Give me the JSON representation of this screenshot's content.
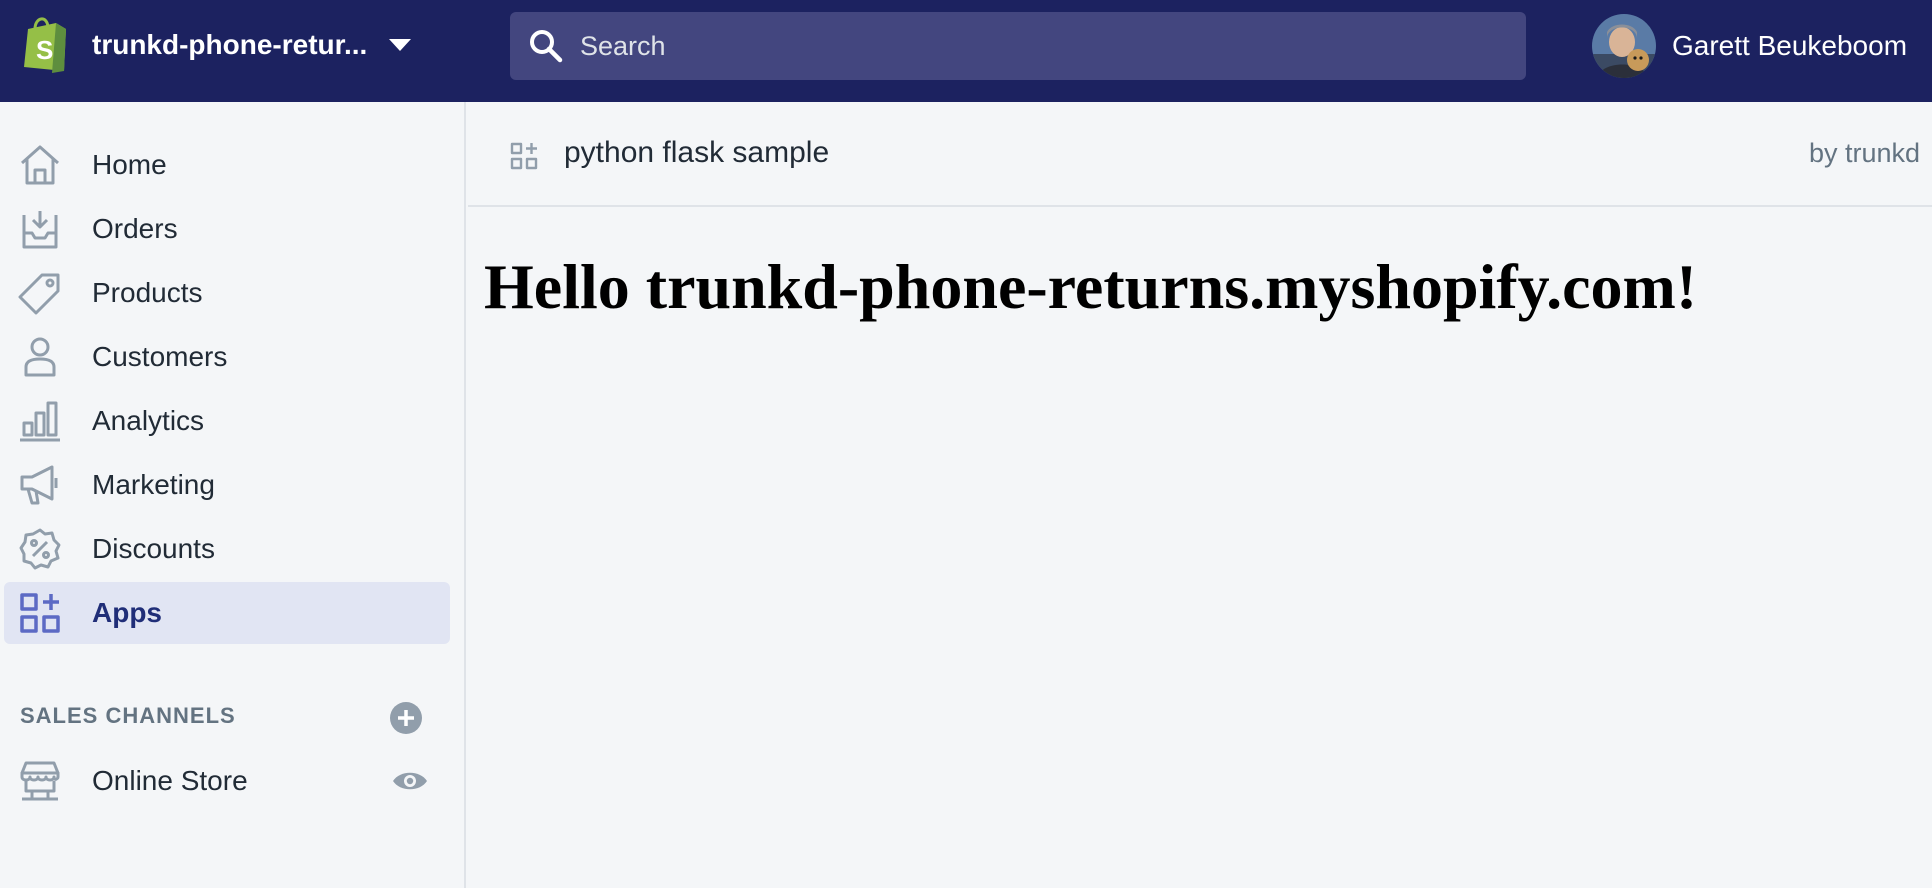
{
  "topbar": {
    "store_name": "trunkd-phone-retur...",
    "search_placeholder": "Search",
    "user_name": "Garett Beukeboom",
    "icons": {
      "logo": "shopify-bag-icon",
      "caret": "chevron-down-icon",
      "search": "search-icon",
      "avatar": "user-avatar"
    }
  },
  "sidebar": {
    "items": [
      {
        "label": "Home",
        "icon": "home-icon"
      },
      {
        "label": "Orders",
        "icon": "orders-inbox-icon"
      },
      {
        "label": "Products",
        "icon": "tag-icon"
      },
      {
        "label": "Customers",
        "icon": "person-icon"
      },
      {
        "label": "Analytics",
        "icon": "bar-chart-icon"
      },
      {
        "label": "Marketing",
        "icon": "megaphone-icon"
      },
      {
        "label": "Discounts",
        "icon": "discount-badge-icon"
      },
      {
        "label": "Apps",
        "icon": "apps-grid-icon",
        "active": true
      }
    ],
    "sales_channels": {
      "title": "SALES CHANNELS",
      "add_icon": "plus-circle-icon",
      "items": [
        {
          "label": "Online Store",
          "icon": "storefront-icon",
          "action_icon": "eye-icon"
        }
      ]
    }
  },
  "app_header": {
    "title": "python flask sample",
    "by": "by trunkd",
    "icon": "apps-grid-icon"
  },
  "content": {
    "heading": "Hello trunkd-phone-returns.myshopify.com!"
  },
  "colors": {
    "topbar_bg": "#1c2260",
    "search_bg": "#43467f",
    "active_nav_bg": "#e1e5f3",
    "active_nav_text": "#202e78",
    "icon_gray": "#919eab",
    "accent_indigo": "#5c6ac4"
  }
}
